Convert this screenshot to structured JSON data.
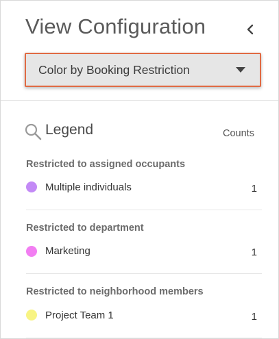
{
  "header": {
    "title": "View Configuration",
    "collapse_icon": "chevron-left-icon"
  },
  "color_by": {
    "selected": "Color by Booking Restriction",
    "icon": "caret-down-icon",
    "highlight_color": "#e06a43"
  },
  "legend": {
    "title": "Legend",
    "search_icon": "search-icon",
    "counts_label": "Counts",
    "groups": [
      {
        "title": "Restricted to assigned occupants",
        "items": [
          {
            "label": "Multiple individuals",
            "count": "1",
            "color": "#c38af6"
          }
        ]
      },
      {
        "title": "Restricted to department",
        "items": [
          {
            "label": "Marketing",
            "count": "1",
            "color": "#f27ef2"
          }
        ]
      },
      {
        "title": "Restricted to neighborhood members",
        "items": [
          {
            "label": "Project Team 1",
            "count": "1",
            "color": "#f8f483"
          }
        ]
      }
    ]
  }
}
